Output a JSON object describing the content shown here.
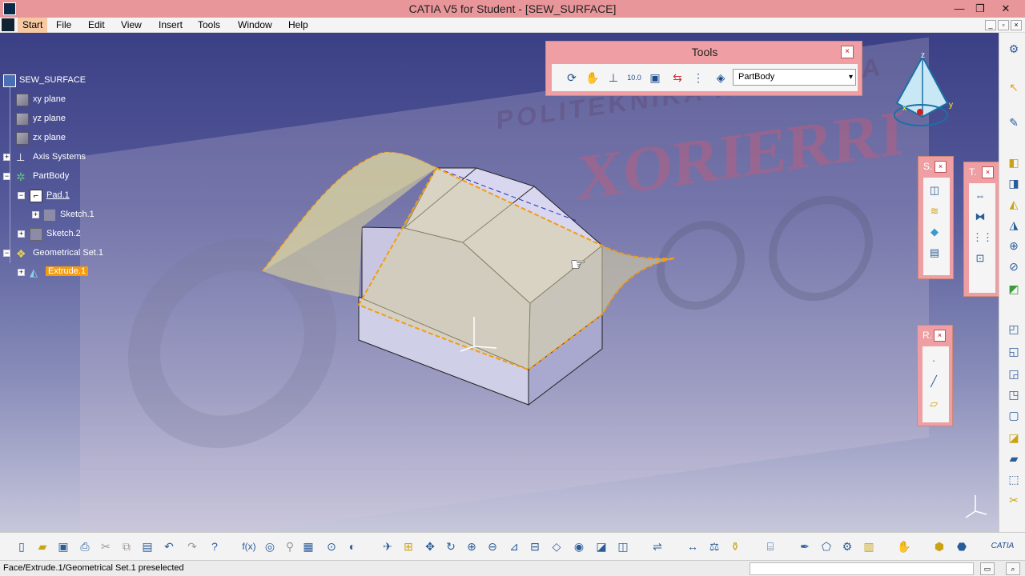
{
  "window": {
    "title": "CATIA V5 for Student - [SEW_SURFACE]",
    "minimize": "—",
    "restore": "❐",
    "close": "✕"
  },
  "menu": {
    "items": [
      "Start",
      "File",
      "Edit",
      "View",
      "Insert",
      "Tools",
      "Window",
      "Help"
    ]
  },
  "tree": {
    "root": "SEW_SURFACE",
    "items": [
      {
        "label": "xy plane",
        "icon": "plane-icon"
      },
      {
        "label": "yz plane",
        "icon": "plane-icon"
      },
      {
        "label": "zx plane",
        "icon": "plane-icon"
      },
      {
        "label": "Axis Systems",
        "icon": "axis-system-icon"
      },
      {
        "label": "PartBody",
        "icon": "partbody-icon"
      },
      {
        "label": "Pad.1",
        "icon": "pad-icon"
      },
      {
        "label": "Sketch.1",
        "icon": "sketch-icon"
      },
      {
        "label": "Sketch.2",
        "icon": "sketch-icon"
      },
      {
        "label": "Geometrical Set.1",
        "icon": "geometrical-set-icon"
      },
      {
        "label": "Extrude.1",
        "icon": "extrude-icon"
      }
    ]
  },
  "tools_toolbar": {
    "title": "Tools",
    "close": "×",
    "selected_body": "PartBody"
  },
  "mini_toolbars": [
    {
      "title": "S.",
      "close": "×"
    },
    {
      "title": "T.",
      "close": "×"
    },
    {
      "title": "R.",
      "close": "×"
    }
  ],
  "watermark": {
    "text": "XORIERRI",
    "subtext": "POLITEKNIKA IKASTEGIA"
  },
  "compass": {
    "x": "x",
    "y": "y",
    "z": "z"
  },
  "statusbar": {
    "message": "Face/Extrude.1/Geometrical Set.1 preselected"
  },
  "colors": {
    "titlebar": "#e9969a",
    "toolbar_frame": "#ef9fa3",
    "selection": "#f39c12",
    "surface_fill": "#d8d2a0"
  }
}
